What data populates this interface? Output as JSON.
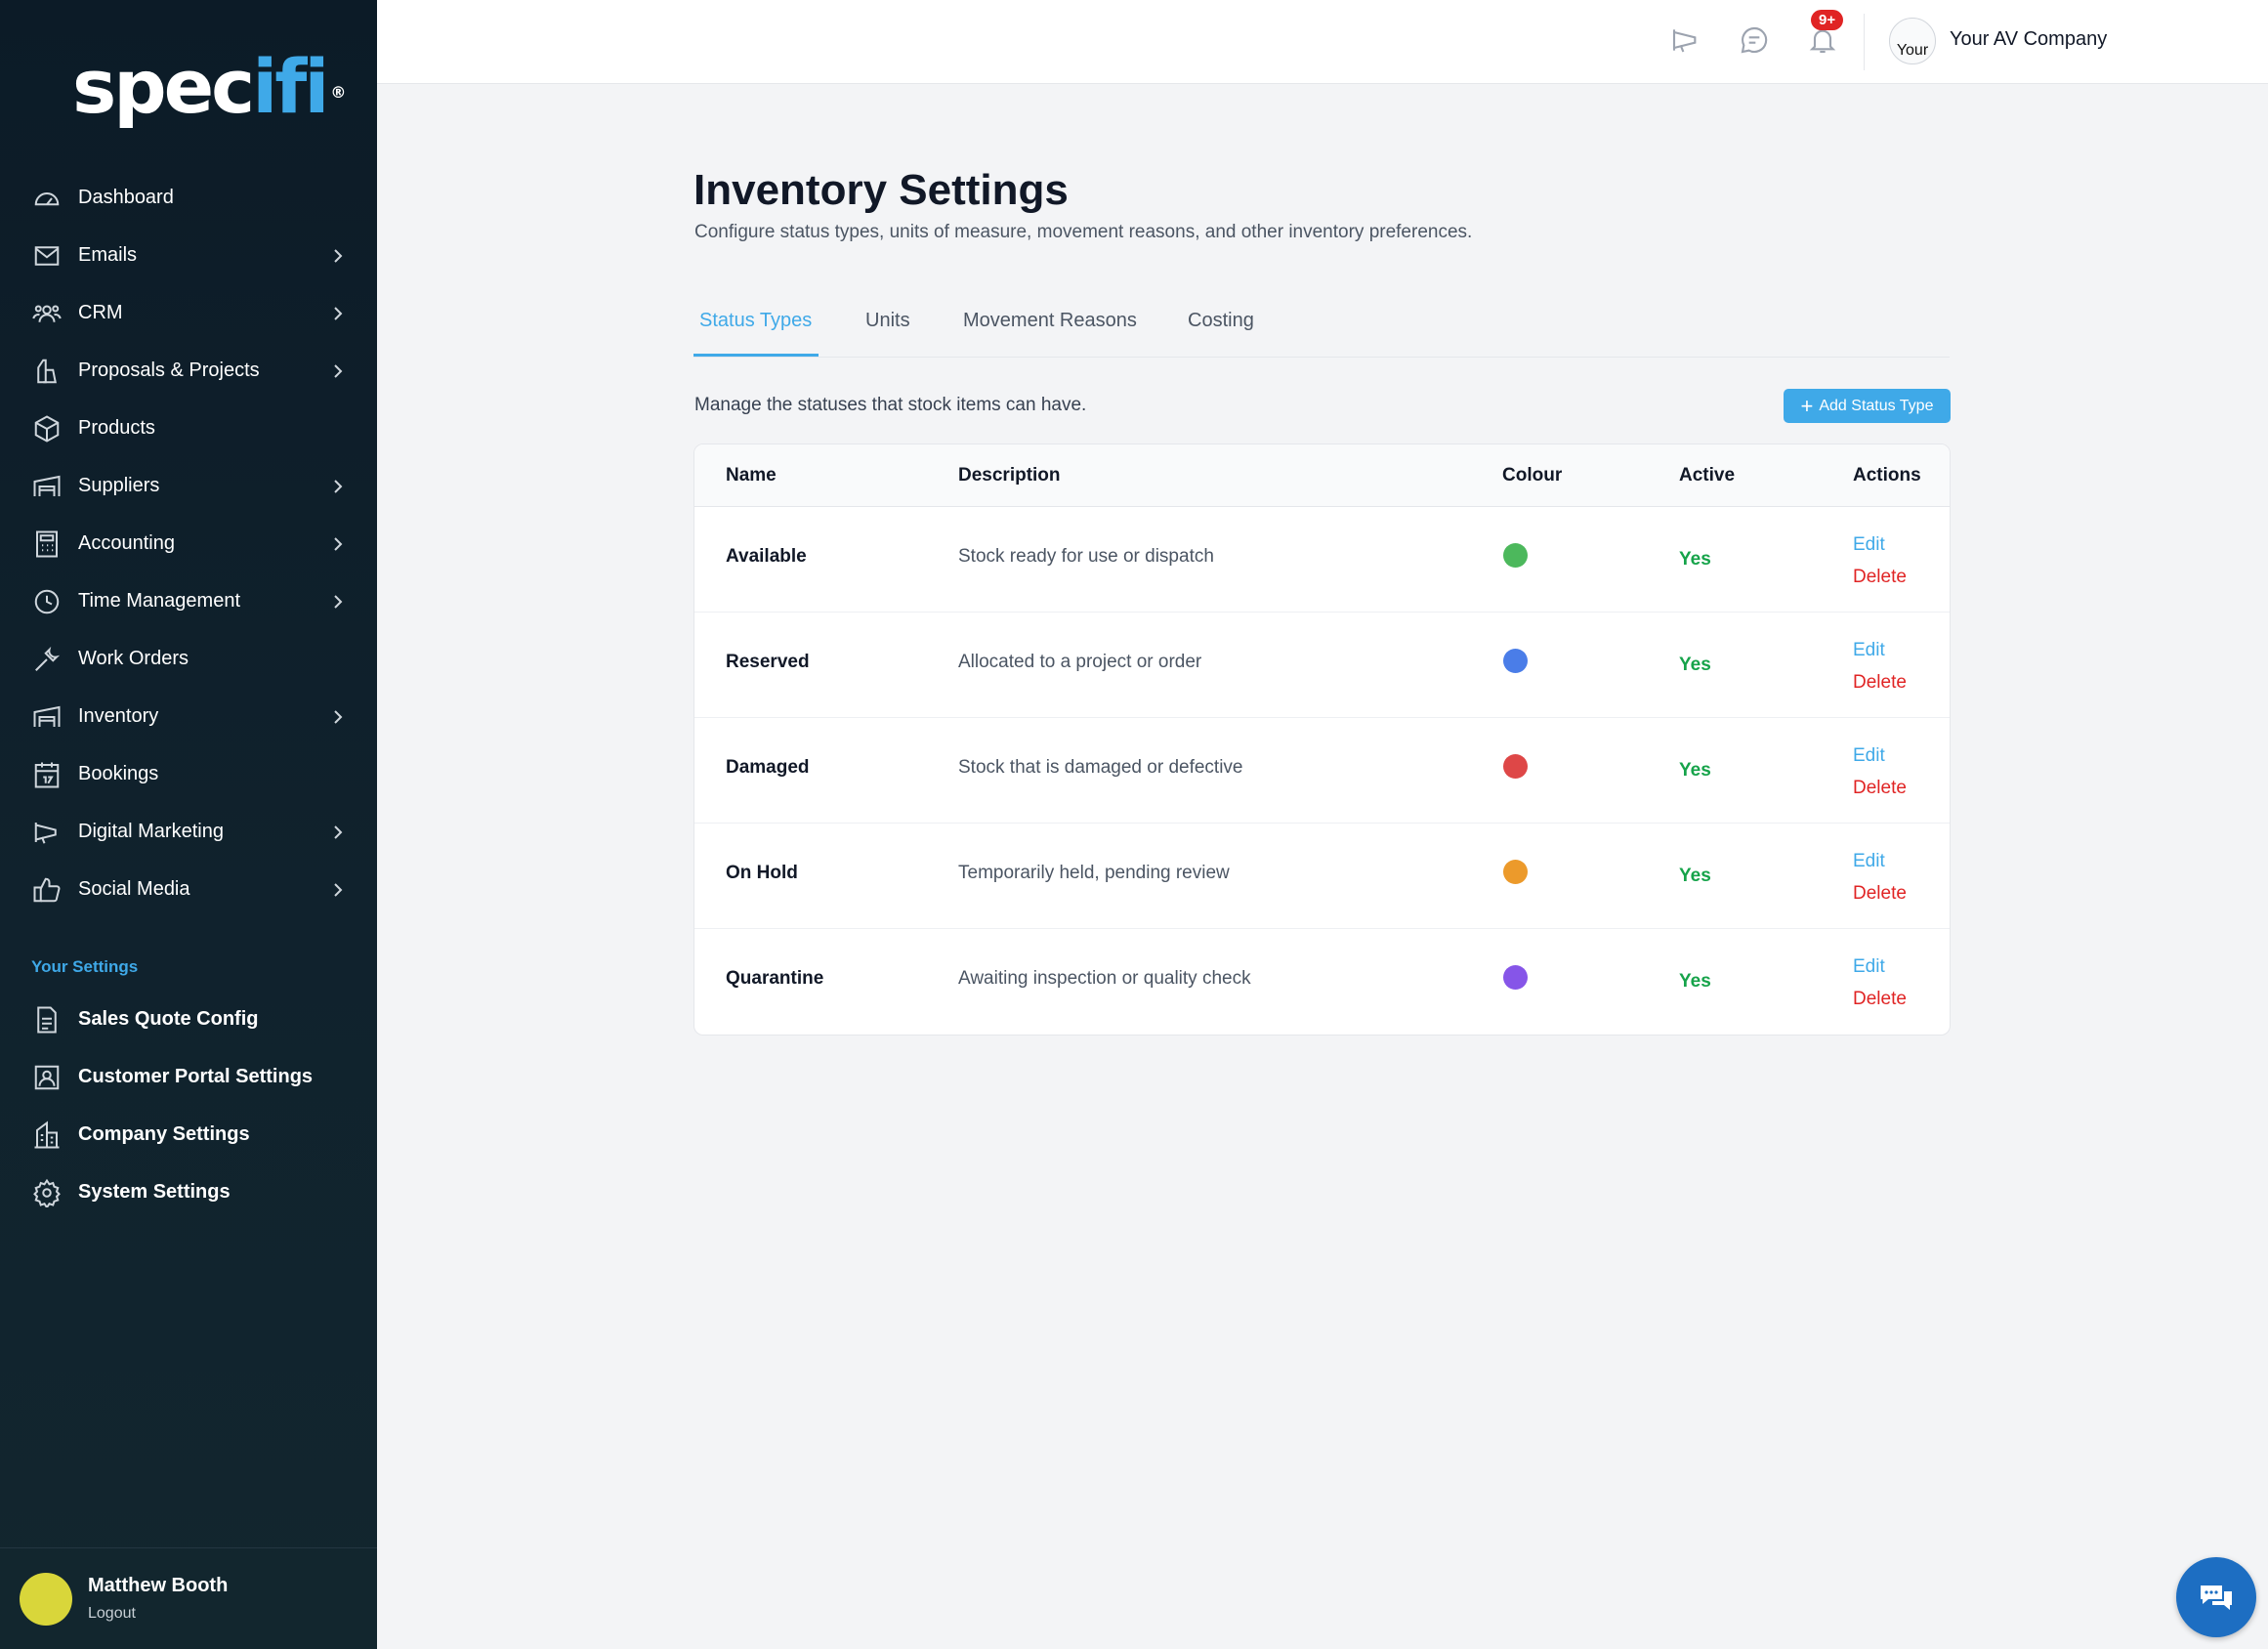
{
  "brand": {
    "logo_main": "spec",
    "logo_accent": "ifi",
    "logo_reg": "®"
  },
  "sidebar": {
    "nav": [
      {
        "label": "Dashboard",
        "icon": "gauge-icon",
        "has_children": false
      },
      {
        "label": "Emails",
        "icon": "envelope-icon",
        "has_children": true
      },
      {
        "label": "CRM",
        "icon": "users-icon",
        "has_children": true
      },
      {
        "label": "Proposals & Projects",
        "icon": "document-pen-icon",
        "has_children": true
      },
      {
        "label": "Products",
        "icon": "box-icon",
        "has_children": false
      },
      {
        "label": "Suppliers",
        "icon": "warehouse-icon",
        "has_children": true
      },
      {
        "label": "Accounting",
        "icon": "calculator-icon",
        "has_children": true
      },
      {
        "label": "Time Management",
        "icon": "clock-icon",
        "has_children": true
      },
      {
        "label": "Work Orders",
        "icon": "wrench-icon",
        "has_children": false
      },
      {
        "label": "Inventory",
        "icon": "warehouse-icon",
        "has_children": true
      },
      {
        "label": "Bookings",
        "icon": "calendar-icon",
        "has_children": false
      },
      {
        "label": "Digital Marketing",
        "icon": "megaphone-icon",
        "has_children": true
      },
      {
        "label": "Social Media",
        "icon": "thumbs-up-icon",
        "has_children": true
      }
    ],
    "settings_heading": "Your Settings",
    "settings": [
      {
        "label": "Sales Quote Config",
        "icon": "file-icon"
      },
      {
        "label": "Customer Portal Settings",
        "icon": "portrait-icon"
      },
      {
        "label": "Company Settings",
        "icon": "building-icon"
      },
      {
        "label": "System Settings",
        "icon": "gear-icon"
      }
    ],
    "user": {
      "name": "Matthew Booth",
      "logout": "Logout"
    }
  },
  "topbar": {
    "notification_badge": "9+",
    "company_avatar_text": "Your",
    "company_name": "Your AV Company"
  },
  "page": {
    "title": "Inventory Settings",
    "subtitle": "Configure status types, units of measure, movement reasons, and other inventory preferences.",
    "tabs": [
      "Status Types",
      "Units",
      "Movement Reasons",
      "Costing"
    ],
    "active_tab": "Status Types",
    "manage_text": "Manage the statuses that stock items can have.",
    "add_button": "Add Status Type"
  },
  "table": {
    "headers": {
      "name": "Name",
      "description": "Description",
      "colour": "Colour",
      "active": "Active",
      "actions": "Actions"
    },
    "edit_label": "Edit",
    "delete_label": "Delete",
    "rows": [
      {
        "name": "Available",
        "description": "Stock ready for use or dispatch",
        "color": "#4cb85c",
        "active": "Yes"
      },
      {
        "name": "Reserved",
        "description": "Allocated to a project or order",
        "color": "#4a7de8",
        "active": "Yes"
      },
      {
        "name": "Damaged",
        "description": "Stock that is damaged or defective",
        "color": "#de4747",
        "active": "Yes"
      },
      {
        "name": "On Hold",
        "description": "Temporarily held, pending review",
        "color": "#ec9a2b",
        "active": "Yes"
      },
      {
        "name": "Quarantine",
        "description": "Awaiting inspection or quality check",
        "color": "#8655e8",
        "active": "Yes"
      }
    ]
  }
}
